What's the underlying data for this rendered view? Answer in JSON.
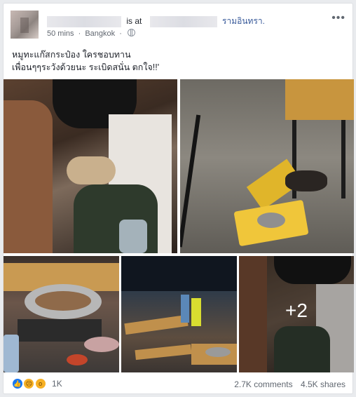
{
  "post": {
    "author_status": "is at",
    "place_name": "รามอินทรา.",
    "time": "50 mins",
    "location": "Bangkok",
    "options_icon": "more-options-icon",
    "caption_lines": [
      "หมูทะแก๊สกระป๋อง ใครชอบทาน",
      "เพื่อนๆๆระวังด้วยนะ ระเบิดสนั่น ตกใจ!!'"
    ],
    "photos": {
      "extra_count": "+2"
    },
    "reactions": {
      "icons": [
        "like-icon",
        "sad-icon",
        "wow-icon"
      ],
      "count": "1K"
    },
    "comments": "2.7K comments",
    "shares": "4.5K shares"
  }
}
